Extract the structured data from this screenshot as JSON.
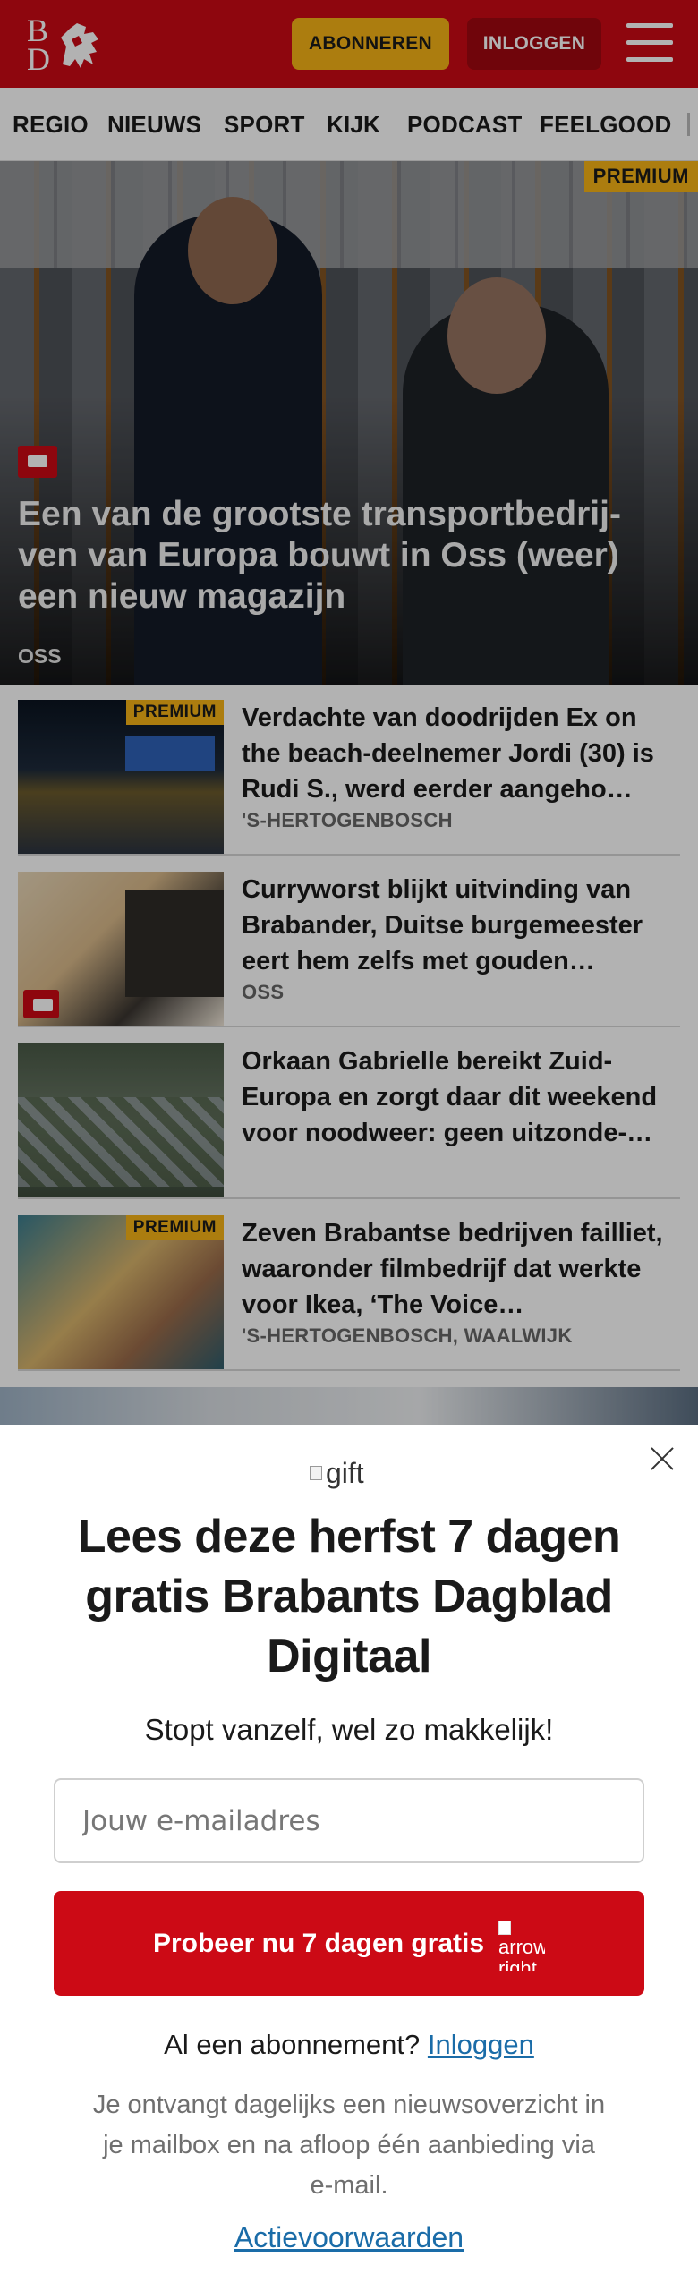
{
  "header": {
    "logo_top": "B",
    "logo_bottom": "D",
    "subscribe_label": "ABONNEREN",
    "login_label": "INLOGGEN",
    "menu_icon": "hamburger-icon",
    "brand_color": "#cc0a15",
    "accent_color": "#f6b416"
  },
  "nav": {
    "items": [
      "REGIO",
      "NIEUWS",
      "SPORT",
      "KIJK",
      "PODCAST",
      "FEELGOOD"
    ]
  },
  "hero": {
    "premium": "PREMIUM",
    "title": "Een van de grootste transportbedrij-ven van Europa bouwt in Oss (weer) een nieuw magazijn",
    "location": "OSS",
    "comment_icon": "comment-icon"
  },
  "articles": [
    {
      "premium": "PREMIUM",
      "title": "Verdachte van doodrijden Ex on the beach-deelnemer Jordi (30) is Rudi S., werd eerder aangeho…",
      "location": "'S-HERTOGENBOSCH"
    },
    {
      "title": "Curryworst blijkt uitvinding van Brabander, Duitse burgemeester eert hem zelfs met gouden…",
      "location": "OSS"
    },
    {
      "title": "Orkaan Gabrielle bereikt Zuid-Europa en zorgt daar dit weekend voor noodweer: geen uitzonde-…",
      "location": ""
    },
    {
      "premium": "PREMIUM",
      "title": "Zeven Brabantse bedrijven failliet, waaronder filmbedrijf dat werkte voor Ikea, ‘The Voice…",
      "location": "'S-HERTOGENBOSCH, WAALWIJK"
    }
  ],
  "modal": {
    "gift_alt": "gift",
    "title": "Lees deze herfst 7 dagen gratis Brabants Dagblad Digitaal",
    "subtitle": "Stopt vanzelf, wel zo makkelijk!",
    "email_placeholder": "Jouw e-mailadres",
    "cta_label": "Probeer nu 7 dagen gratis",
    "cta_icon_alt": "arrow right",
    "login_prompt": "Al een abonnement?",
    "login_link": "Inloggen",
    "info": "Je ontvangt dagelijks een nieuwsoverzicht in je mailbox en na afloop één aanbieding via e-mail.",
    "terms_link": "Actievoorwaarden",
    "link_color": "#1a6ca8"
  }
}
